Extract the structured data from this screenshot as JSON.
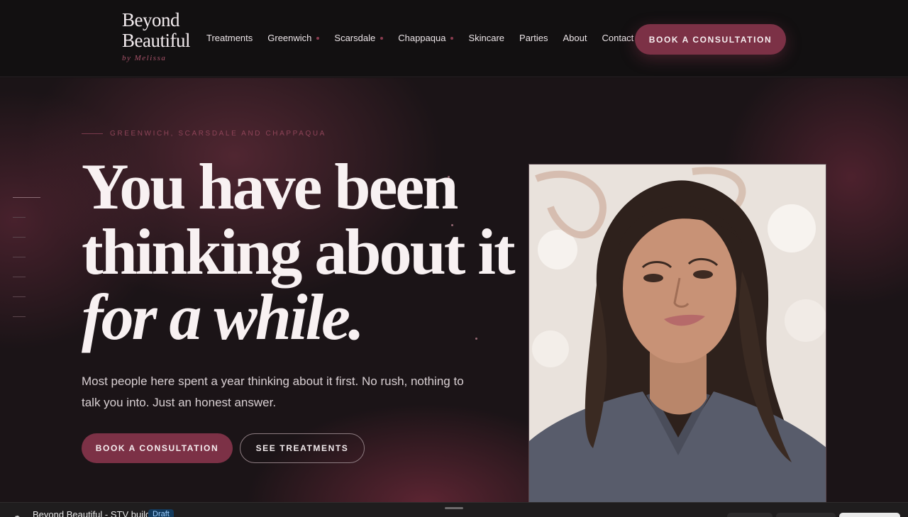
{
  "brand": {
    "name_line1": "Beyond",
    "name_line2": "Beautiful",
    "tagline": "by Melissa"
  },
  "nav": [
    {
      "label": "Treatments",
      "has_dot": false
    },
    {
      "label": "Greenwich",
      "has_dot": true
    },
    {
      "label": "Scarsdale",
      "has_dot": true
    },
    {
      "label": "Chappaqua",
      "has_dot": true
    },
    {
      "label": "Skincare",
      "has_dot": false
    },
    {
      "label": "Parties",
      "has_dot": false
    },
    {
      "label": "About",
      "has_dot": false
    },
    {
      "label": "Contact",
      "has_dot": false
    }
  ],
  "header_cta": "BOOK A CONSULTATION",
  "hero": {
    "eyebrow": "GREENWICH, SCARSDALE AND CHAPPAQUA",
    "headline_line1": "You have been",
    "headline_line2": "thinking about it",
    "headline_line3": "for a while.",
    "subtext": "Most people here spent a year thinking about it first. No rush, nothing to talk you into. Just an honest answer.",
    "primary_button": "BOOK A CONSULTATION",
    "secondary_button": "SEE TREATMENTS",
    "portrait_icon": "portrait-photo"
  },
  "bottom_bar": {
    "title": "Beyond Beautiful - STV build",
    "badge": "Draft"
  },
  "colors": {
    "accent": "#7c3146",
    "background": "#1b1417",
    "eyebrow": "#8e4458"
  }
}
